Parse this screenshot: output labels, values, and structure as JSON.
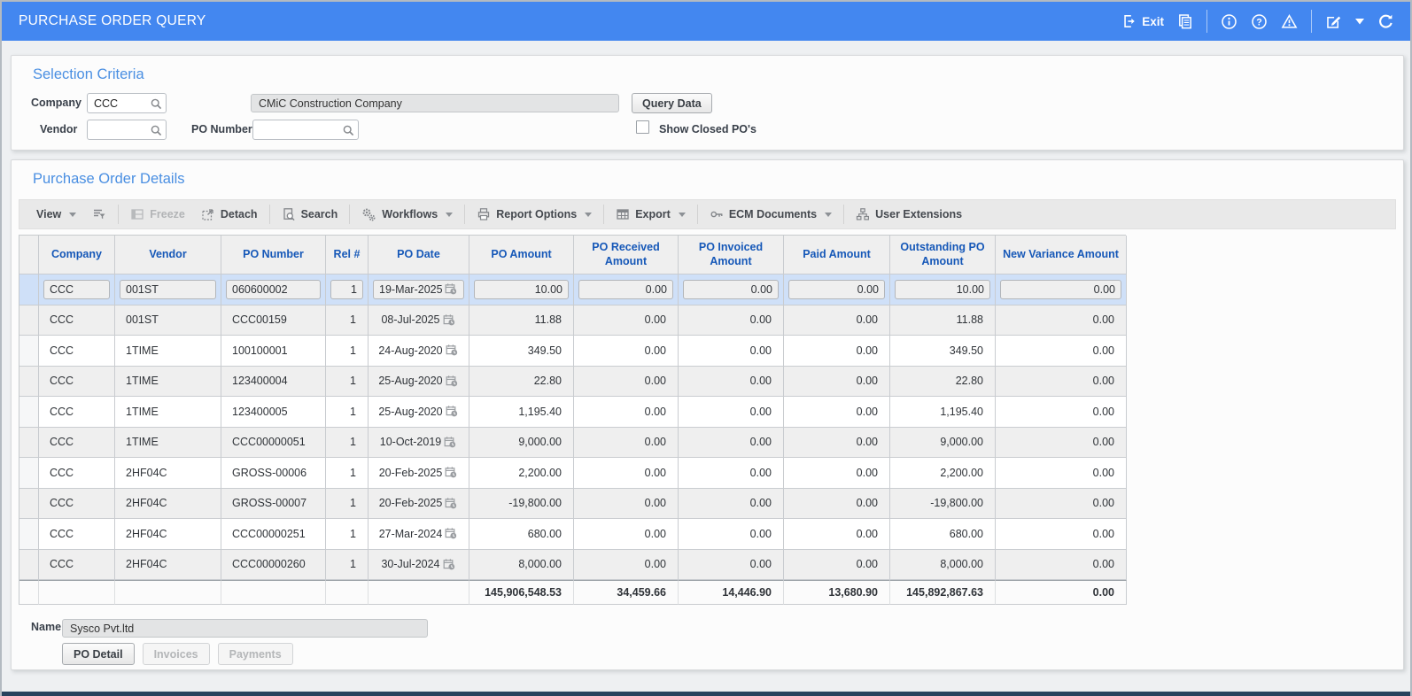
{
  "titlebar": {
    "title": "PURCHASE ORDER QUERY",
    "exit_label": "Exit",
    "icons": [
      "exit-icon",
      "pages-icon",
      "info-icon",
      "help-icon",
      "warning-icon",
      "edit-icon",
      "caret-down-icon",
      "refresh-icon"
    ],
    "color": "#4387f0"
  },
  "selection_criteria": {
    "title": "Selection Criteria",
    "company": {
      "label": "Company",
      "value": "CCC",
      "name_value": "CMiC Construction Company"
    },
    "vendor": {
      "label": "Vendor",
      "value": ""
    },
    "po_number": {
      "label": "PO Number",
      "value": ""
    },
    "query_button_label": "Query Data",
    "show_closed_label": "Show Closed PO's",
    "show_closed_checked": false
  },
  "po_details": {
    "title": "Purchase Order Details",
    "toolbar": {
      "items": [
        {
          "name": "view-menu",
          "label": "View",
          "icon": "",
          "caret": true,
          "disabled": false
        },
        {
          "name": "qbe-button",
          "label": "",
          "icon": "qbe-icon",
          "caret": false,
          "disabled": false
        },
        {
          "name": "freeze-button",
          "label": "Freeze",
          "icon": "freeze-icon",
          "caret": false,
          "disabled": true
        },
        {
          "name": "detach-button",
          "label": "Detach",
          "icon": "detach-icon",
          "caret": false,
          "disabled": false
        },
        {
          "name": "search-button",
          "label": "Search",
          "icon": "search-icon",
          "caret": false,
          "disabled": false
        },
        {
          "name": "workflows-menu",
          "label": "Workflows",
          "icon": "workflows-icon",
          "caret": true,
          "disabled": false
        },
        {
          "name": "report-options-menu",
          "label": "Report Options",
          "icon": "report-options-icon",
          "caret": true,
          "disabled": false
        },
        {
          "name": "export-menu",
          "label": "Export",
          "icon": "export-icon",
          "caret": true,
          "disabled": false
        },
        {
          "name": "ecm-documents-menu",
          "label": "ECM Documents",
          "icon": "ecm-documents-icon",
          "caret": true,
          "disabled": false
        },
        {
          "name": "user-extensions-button",
          "label": "User Extensions",
          "icon": "user-extensions-icon",
          "caret": false,
          "disabled": false
        }
      ],
      "separators_after": [
        1,
        3,
        4,
        5,
        6,
        7,
        8
      ]
    },
    "table": {
      "columns": [
        "Company",
        "Vendor",
        "PO Number",
        "Rel #",
        "PO Date",
        "PO Amount",
        "PO Received Amount",
        "PO Invoiced Amount",
        "Paid Amount",
        "Outstanding PO Amount",
        "New Variance Amount"
      ],
      "rows": [
        {
          "selected": true,
          "company": "CCC",
          "vendor": "001ST",
          "po_number": "060600002",
          "rel": "1",
          "po_date": "19-Mar-2025",
          "po_amount": "10.00",
          "po_received": "0.00",
          "po_invoiced": "0.00",
          "paid": "0.00",
          "outstanding": "10.00",
          "variance": "0.00"
        },
        {
          "selected": false,
          "company": "CCC",
          "vendor": "001ST",
          "po_number": "CCC00159",
          "rel": "1",
          "po_date": "08-Jul-2025",
          "po_amount": "11.88",
          "po_received": "0.00",
          "po_invoiced": "0.00",
          "paid": "0.00",
          "outstanding": "11.88",
          "variance": "0.00"
        },
        {
          "selected": false,
          "company": "CCC",
          "vendor": "1TIME",
          "po_number": "100100001",
          "rel": "1",
          "po_date": "24-Aug-2020",
          "po_amount": "349.50",
          "po_received": "0.00",
          "po_invoiced": "0.00",
          "paid": "0.00",
          "outstanding": "349.50",
          "variance": "0.00"
        },
        {
          "selected": false,
          "company": "CCC",
          "vendor": "1TIME",
          "po_number": "123400004",
          "rel": "1",
          "po_date": "25-Aug-2020",
          "po_amount": "22.80",
          "po_received": "0.00",
          "po_invoiced": "0.00",
          "paid": "0.00",
          "outstanding": "22.80",
          "variance": "0.00"
        },
        {
          "selected": false,
          "company": "CCC",
          "vendor": "1TIME",
          "po_number": "123400005",
          "rel": "1",
          "po_date": "25-Aug-2020",
          "po_amount": "1,195.40",
          "po_received": "0.00",
          "po_invoiced": "0.00",
          "paid": "0.00",
          "outstanding": "1,195.40",
          "variance": "0.00"
        },
        {
          "selected": false,
          "company": "CCC",
          "vendor": "1TIME",
          "po_number": "CCC00000051",
          "rel": "1",
          "po_date": "10-Oct-2019",
          "po_amount": "9,000.00",
          "po_received": "0.00",
          "po_invoiced": "0.00",
          "paid": "0.00",
          "outstanding": "9,000.00",
          "variance": "0.00"
        },
        {
          "selected": false,
          "company": "CCC",
          "vendor": "2HF04C",
          "po_number": "GROSS-00006",
          "rel": "1",
          "po_date": "20-Feb-2025",
          "po_amount": "2,200.00",
          "po_received": "0.00",
          "po_invoiced": "0.00",
          "paid": "0.00",
          "outstanding": "2,200.00",
          "variance": "0.00"
        },
        {
          "selected": false,
          "company": "CCC",
          "vendor": "2HF04C",
          "po_number": "GROSS-00007",
          "rel": "1",
          "po_date": "20-Feb-2025",
          "po_amount": "-19,800.00",
          "po_received": "0.00",
          "po_invoiced": "0.00",
          "paid": "0.00",
          "outstanding": "-19,800.00",
          "variance": "0.00"
        },
        {
          "selected": false,
          "company": "CCC",
          "vendor": "2HF04C",
          "po_number": "CCC00000251",
          "rel": "1",
          "po_date": "27-Mar-2024",
          "po_amount": "680.00",
          "po_received": "0.00",
          "po_invoiced": "0.00",
          "paid": "0.00",
          "outstanding": "680.00",
          "variance": "0.00"
        },
        {
          "selected": false,
          "company": "CCC",
          "vendor": "2HF04C",
          "po_number": "CCC00000260",
          "rel": "1",
          "po_date": "30-Jul-2024",
          "po_amount": "8,000.00",
          "po_received": "0.00",
          "po_invoiced": "0.00",
          "paid": "0.00",
          "outstanding": "8,000.00",
          "variance": "0.00"
        }
      ],
      "totals": {
        "po_amount": "145,906,548.53",
        "po_received": "34,459.66",
        "po_invoiced": "14,446.90",
        "paid": "13,680.90",
        "outstanding": "145,892,867.63",
        "variance": "0.00"
      }
    },
    "footer": {
      "name_label": "Name",
      "name_value": "Sysco Pvt.ltd",
      "buttons": [
        {
          "name": "po-detail-button",
          "label": "PO Detail",
          "enabled": true
        },
        {
          "name": "invoices-button",
          "label": "Invoices",
          "enabled": false
        },
        {
          "name": "payments-button",
          "label": "Payments",
          "enabled": false
        }
      ]
    }
  },
  "colors": {
    "titlebar_blue": "#4387f0",
    "section_title_blue": "#4a8fe2",
    "table_header_blue": "#1658b8",
    "selected_row_blue": "#cfe0f8",
    "band_gray": "#efefef",
    "bottom_edge_navy": "#28435e"
  }
}
